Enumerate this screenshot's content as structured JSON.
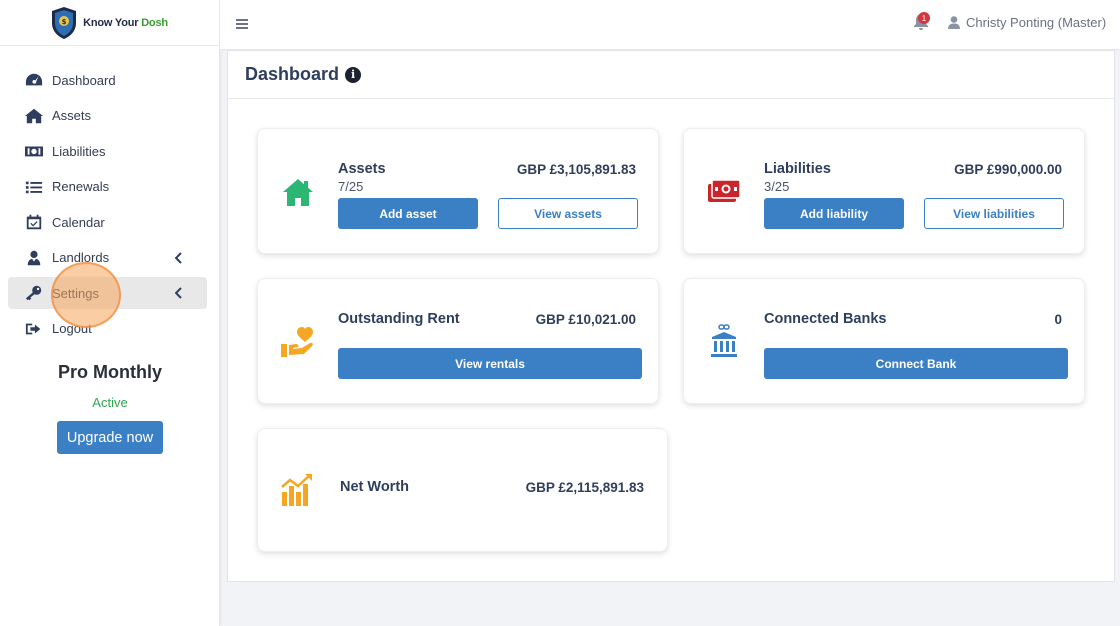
{
  "brand": {
    "name_part1": "Know Your ",
    "name_part2": "Dosh"
  },
  "sidebar": {
    "items": [
      {
        "label": "Dashboard",
        "icon": "tachometer-icon"
      },
      {
        "label": "Assets",
        "icon": "home-icon"
      },
      {
        "label": "Liabilities",
        "icon": "money-bill-icon"
      },
      {
        "label": "Renewals",
        "icon": "list-icon"
      },
      {
        "label": "Calendar",
        "icon": "calendar-check-icon"
      },
      {
        "label": "Landlords",
        "icon": "user-tie-icon"
      },
      {
        "label": "Settings",
        "icon": "key-icon"
      },
      {
        "label": "Logout",
        "icon": "sign-out-icon"
      }
    ],
    "plan": {
      "name": "Pro Monthly",
      "status": "Active",
      "upgrade_label": "Upgrade now"
    }
  },
  "topbar": {
    "notification_count": "1",
    "user_name": "Christy Ponting (Master)"
  },
  "page": {
    "title": "Dashboard"
  },
  "cards": {
    "assets": {
      "title": "Assets",
      "value": "GBP £3,105,891.83",
      "count": "7/25",
      "primary_label": "Add asset",
      "secondary_label": "View assets"
    },
    "liabilities": {
      "title": "Liabilities",
      "value": "GBP £990,000.00",
      "count": "3/25",
      "primary_label": "Add liability",
      "secondary_label": "View liabilities"
    },
    "rent": {
      "title": "Outstanding Rent",
      "value": "GBP £10,021.00",
      "primary_label": "View rentals"
    },
    "banks": {
      "title": "Connected Banks",
      "value": "0",
      "primary_label": "Connect Bank"
    },
    "networth": {
      "title": "Net Worth",
      "value": "GBP £2,115,891.83"
    }
  },
  "colors": {
    "accent": "#3b7fc4",
    "assets_icon": "#2bb673",
    "liabilities_icon": "#c8252c",
    "rent_icon": "#f5a623",
    "banks_icon": "#3b7fc4",
    "networth_icon": "#f5a623",
    "active_status": "#2fa84f"
  }
}
